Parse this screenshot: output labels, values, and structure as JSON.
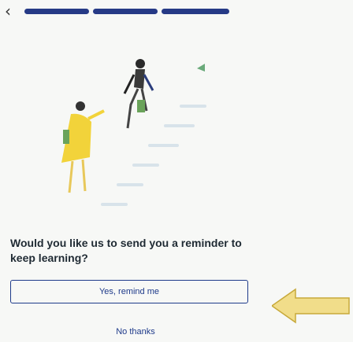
{
  "header": {
    "back_icon": "chevron-left-icon",
    "progress_segments": 3,
    "progress_color": "#263a86"
  },
  "illustration": {
    "name": "people-climbing-stairs-illustration",
    "accent": "#f2d33a"
  },
  "reminder": {
    "prompt": "Would you like us to send you a reminder to keep learning?",
    "primary_label": "Yes, remind me",
    "secondary_label": "No thanks"
  },
  "annotation": {
    "icon": "arrow-left-icon",
    "color": "#f1dd8a"
  }
}
